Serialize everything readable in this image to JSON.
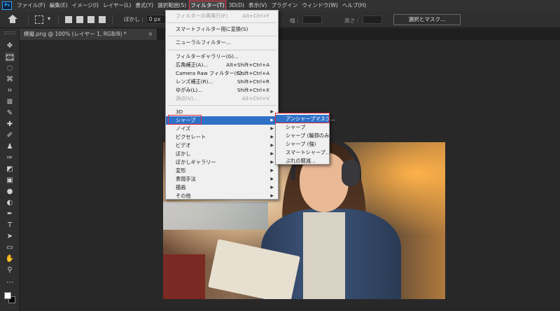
{
  "app": {
    "logo": "Ps"
  },
  "menubar": {
    "items": [
      "ファイル(F)",
      "編集(E)",
      "イメージ(I)",
      "レイヤー(L)",
      "書式(Y)",
      "選択範囲(S)",
      "フィルター(T)",
      "3D(D)",
      "表示(V)",
      "プラグイン",
      "ウィンドウ(W)",
      "ヘルプ(H)"
    ],
    "active_index": 6
  },
  "options": {
    "feather_label": "ぼかし :",
    "feather_value": "0 px",
    "width_label": "幅 :",
    "height_label": "高さ :",
    "select_mask_label": "選択とマスク..."
  },
  "document": {
    "tab_title": "模擬.png @ 100% (レイヤー 1, RGB/8) *",
    "close_glyph": "×"
  },
  "tools": [
    "move-tool",
    "marquee-tool",
    "lasso-tool",
    "quick-select-tool",
    "crop-tool",
    "frame-tool",
    "eyedropper-tool",
    "healing-brush-tool",
    "brush-tool",
    "clone-stamp-tool",
    "history-brush-tool",
    "eraser-tool",
    "gradient-tool",
    "blur-tool",
    "dodge-tool",
    "pen-tool",
    "type-tool",
    "path-select-tool",
    "rectangle-tool",
    "hand-tool",
    "zoom-tool"
  ],
  "filter_menu": {
    "items": [
      {
        "label": "フィルターの再実行(F)",
        "shortcut": "Alt+Ctrl+F",
        "disabled": true
      },
      {
        "label": "スマートフィルター用に変換(S)",
        "shortcut": "",
        "disabled": false
      },
      {
        "label": "ニューラルフィルター...",
        "shortcut": "",
        "disabled": false
      },
      {
        "label": "フィルターギャラリー(G)...",
        "shortcut": "",
        "disabled": false
      },
      {
        "label": "広角補正(A)...",
        "shortcut": "Alt+Shift+Ctrl+A",
        "disabled": false
      },
      {
        "label": "Camera Raw フィルター(C)...",
        "shortcut": "Shift+Ctrl+A",
        "disabled": false
      },
      {
        "label": "レンズ補正(R)...",
        "shortcut": "Shift+Ctrl+R",
        "disabled": false
      },
      {
        "label": "ゆがみ(L)...",
        "shortcut": "Shift+Ctrl+X",
        "disabled": false
      },
      {
        "label": "消点(V)...",
        "shortcut": "Alt+Ctrl+V",
        "disabled": true
      },
      {
        "label": "3D",
        "submenu": true
      },
      {
        "label": "シャープ",
        "submenu": true,
        "highlight": true
      },
      {
        "label": "ノイズ",
        "submenu": true
      },
      {
        "label": "ピクセレート",
        "submenu": true
      },
      {
        "label": "ビデオ",
        "submenu": true
      },
      {
        "label": "ぼかし",
        "submenu": true
      },
      {
        "label": "ぼかしギャラリー",
        "submenu": true
      },
      {
        "label": "変形",
        "submenu": true
      },
      {
        "label": "表現手法",
        "submenu": true
      },
      {
        "label": "描画",
        "submenu": true
      },
      {
        "label": "その他",
        "submenu": true
      }
    ],
    "submenu_arrow": "▶"
  },
  "sharpen_submenu": {
    "items": [
      "アンシャープマスク...",
      "シャープ",
      "シャープ (輪郭のみ)",
      "シャープ (強)",
      "スマートシャープ...",
      "ぶれの軽減..."
    ],
    "highlight_index": 0
  },
  "colors": {
    "accent_highlight": "#2e71c7",
    "annotation_red": "#e0283a"
  }
}
